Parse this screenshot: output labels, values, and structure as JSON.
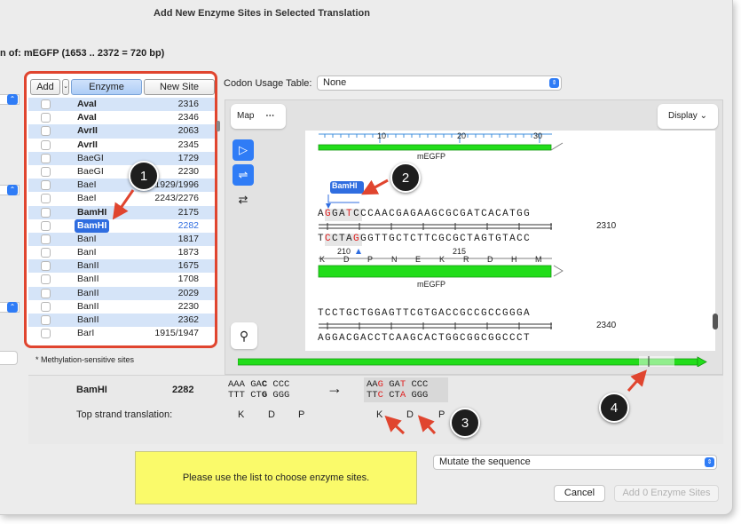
{
  "window": {
    "title": "Add New Enzyme Sites in Selected Translation",
    "subtitle": "n of:  mEGFP  (1653 .. 2372  =  720 bp)"
  },
  "table": {
    "add_label": "Add",
    "enzyme_col": "Enzyme",
    "site_col": "New Site",
    "rows": [
      {
        "name": "AvaI",
        "site": "2316",
        "bold": true
      },
      {
        "name": "AvaI",
        "site": "2346",
        "bold": true
      },
      {
        "name": "AvrII",
        "site": "2063",
        "bold": true
      },
      {
        "name": "AvrII",
        "site": "2345",
        "bold": true
      },
      {
        "name": "BaeGI",
        "site": "1729",
        "bold": false
      },
      {
        "name": "BaeGI",
        "site": "2230",
        "bold": false
      },
      {
        "name": "BaeI",
        "site": "1929/1996",
        "bold": false
      },
      {
        "name": "BaeI",
        "site": "2243/2276",
        "bold": false
      },
      {
        "name": "BamHI",
        "site": "2175",
        "bold": true
      },
      {
        "name": "BamHI",
        "site": "2282",
        "bold": true
      },
      {
        "name": "BanI",
        "site": "1817",
        "bold": false
      },
      {
        "name": "BanI",
        "site": "1873",
        "bold": false
      },
      {
        "name": "BanII",
        "site": "1675",
        "bold": false
      },
      {
        "name": "BanII",
        "site": "1708",
        "bold": false
      },
      {
        "name": "BanII",
        "site": "2029",
        "bold": false
      },
      {
        "name": "BanII",
        "site": "2230",
        "bold": false
      },
      {
        "name": "BanII",
        "site": "2362",
        "bold": false
      },
      {
        "name": "BarI",
        "site": "1915/1947",
        "bold": false
      }
    ],
    "methylation_note": "* Methylation-sensitive sites"
  },
  "codon": {
    "label": "Codon Usage Table:",
    "value": "None"
  },
  "map": {
    "map_label": "Map",
    "more": "⋯",
    "display_label": "Display",
    "ruler_ticks": [
      "10",
      "20",
      "30"
    ],
    "feature_name": "mEGFP",
    "enzyme_tag": "BamHI",
    "top_seq_1": "AGGATCCCAACGAGAAGCGCGATCACATGG",
    "bottom_seq_1": "TCCTAGGGTTGCTCTTCGCGCTAGTGTACC",
    "pos_1": "2310",
    "ruler_2": [
      "210",
      "215"
    ],
    "aa_row": [
      "K",
      "D",
      "P",
      "N",
      "E",
      "K",
      "R",
      "D",
      "H",
      "M"
    ],
    "top_seq_2": "TCCTGCTGGAGTTCGTGACCGCCGCCGGGA",
    "bottom_seq_2": "AGGACGACCTCAAGCACTGGCGGCGGCCCT",
    "pos_2": "2340"
  },
  "mutation": {
    "enzyme": "BamHI",
    "site": "2282",
    "from_top": "AAA GAC CCC",
    "from_bottom": "TTT CTG GGG",
    "arrow": "→",
    "to_top": "AAG GAT CCC",
    "to_bottom": "TTC CTA GGG",
    "translation_label": "Top strand translation:",
    "from_aa": [
      "K",
      "D",
      "P"
    ],
    "to_aa": [
      "K",
      "D",
      "P"
    ]
  },
  "message": "Please use the list to choose enzyme sites.",
  "mutate_select": "Mutate the sequence",
  "buttons": {
    "cancel": "Cancel",
    "add": "Add 0 Enzyme Sites"
  },
  "callouts": [
    "1",
    "2",
    "3",
    "4"
  ],
  "colors": {
    "accent": "#2f7cf6",
    "callout_red": "#e0452f",
    "feature_green": "#22dd1a",
    "message_yellow": "#fafa6a"
  }
}
